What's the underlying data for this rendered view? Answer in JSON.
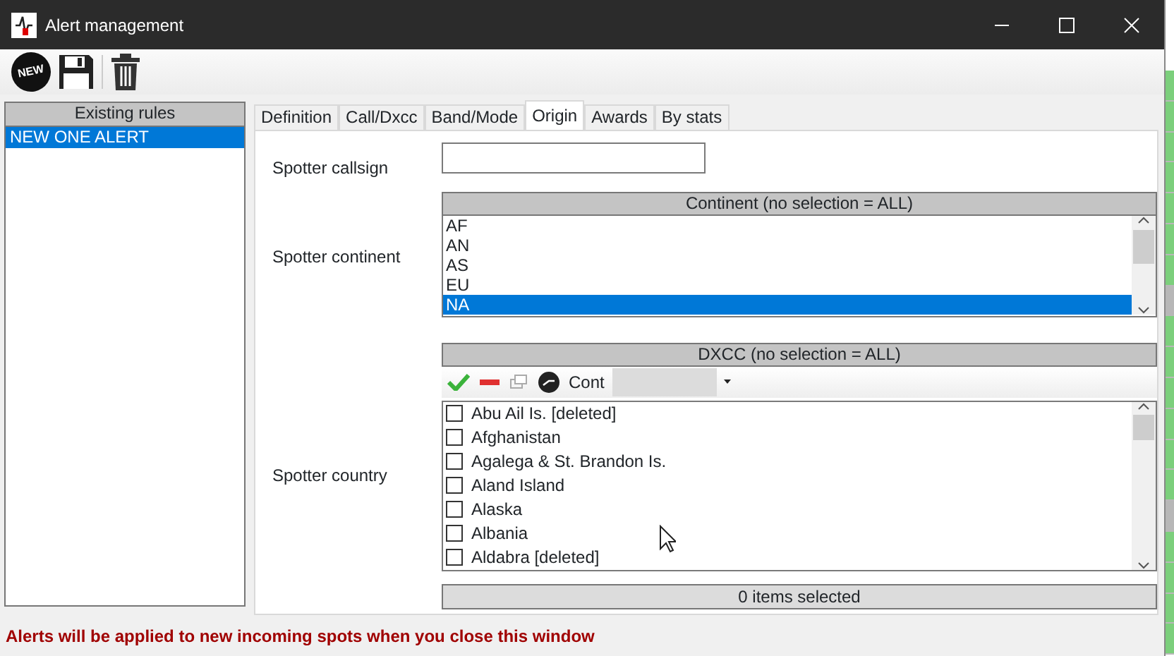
{
  "window": {
    "title": "Alert management"
  },
  "toolbar": [
    {
      "kind": "new",
      "label": "NEW"
    },
    {
      "kind": "save"
    },
    {
      "kind": "delete"
    }
  ],
  "rules_panel": {
    "header": "Existing rules",
    "items": [
      {
        "label": "NEW ONE ALERT",
        "selected": true
      }
    ]
  },
  "tabs": [
    {
      "label": "Definition",
      "selected": false
    },
    {
      "label": "Call/Dxcc",
      "selected": false
    },
    {
      "label": "Band/Mode",
      "selected": false
    },
    {
      "label": "Origin",
      "selected": true
    },
    {
      "label": "Awards",
      "selected": false
    },
    {
      "label": "By stats",
      "selected": false
    }
  ],
  "origin": {
    "callsign_label": "Spotter callsign",
    "continent_label": "Spotter continent",
    "continent_header": "Continent (no selection = ALL)",
    "continents": [
      {
        "label": "AF",
        "selected": false
      },
      {
        "label": "AN",
        "selected": false
      },
      {
        "label": "AS",
        "selected": false
      },
      {
        "label": "EU",
        "selected": false
      },
      {
        "label": "NA",
        "selected": true
      }
    ],
    "country_label": "Spotter country",
    "dxcc_header": "DXCC (no selection = ALL)",
    "cont_label": "Cont",
    "countries": [
      {
        "label": "Abu Ail Is. [deleted]",
        "checked": false
      },
      {
        "label": "Afghanistan",
        "checked": false
      },
      {
        "label": "Agalega & St. Brandon Is.",
        "checked": false
      },
      {
        "label": "Aland Island",
        "checked": false
      },
      {
        "label": "Alaska",
        "checked": false
      },
      {
        "label": "Albania",
        "checked": false
      },
      {
        "label": "Aldabra [deleted]",
        "checked": false
      }
    ],
    "selection_count": "0 items selected"
  },
  "status_message": "Alerts will be applied to new incoming spots when you close this window",
  "background_column": [
    {
      "shaded": false
    },
    {
      "shaded": false
    },
    {
      "shaded": false
    },
    {
      "shaded": false
    },
    {
      "shaded": false
    },
    {
      "shaded": false
    },
    {
      "shaded": false
    },
    {
      "shaded": true
    },
    {
      "shaded": false
    },
    {
      "shaded": false
    },
    {
      "shaded": false
    },
    {
      "shaded": false
    },
    {
      "shaded": false
    },
    {
      "shaded": false
    },
    {
      "shaded": true
    },
    {
      "shaded": false
    },
    {
      "shaded": false
    },
    {
      "shaded": false
    },
    {
      "shaded": false
    }
  ]
}
